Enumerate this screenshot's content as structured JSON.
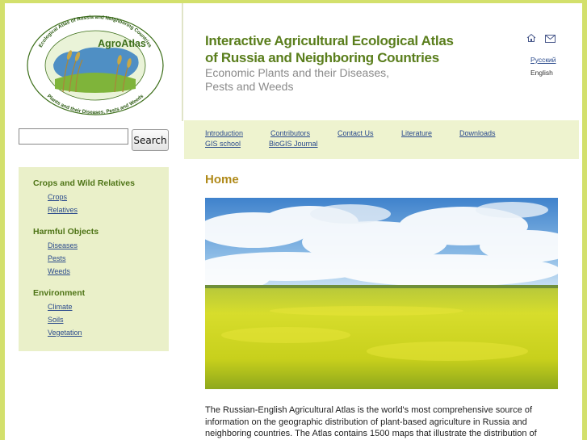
{
  "logo": {
    "brand": "AgroAtlas",
    "ring_text_top": "Ecological Atlas of Russia and Neighboring Countries",
    "ring_text_bottom": "Plants and their Diseases, Pests and Weeds"
  },
  "header": {
    "title_line1": "Interactive Agricultural Ecological Atlas",
    "title_line2": "of Russia and Neighboring Countries",
    "subtitle_line1": "Economic Plants and their Diseases,",
    "subtitle_line2": "Pests and Weeds"
  },
  "utility": {
    "home_icon": "home-icon",
    "mail_icon": "mail-icon",
    "lang_russian": "Русский",
    "lang_english": "English"
  },
  "search": {
    "button_label": "Search",
    "value": ""
  },
  "nav": [
    {
      "label": "Introduction"
    },
    {
      "label": "Contributors"
    },
    {
      "label": "Contact Us"
    },
    {
      "label": "Literature"
    },
    {
      "label": "Downloads"
    },
    {
      "label": "GIS school"
    },
    {
      "label": "BioGIS Journal"
    }
  ],
  "sidebar": {
    "sections": [
      {
        "heading": "Crops and Wild Relatives",
        "links": [
          "Crops",
          "Relatives"
        ]
      },
      {
        "heading": "Harmful Objects",
        "links": [
          "Diseases",
          "Pests",
          "Weeds"
        ]
      },
      {
        "heading": "Environment",
        "links": [
          "Climate",
          "Soils",
          "Vegetation"
        ]
      }
    ]
  },
  "main": {
    "page_title": "Home",
    "hero_alt": "rapeseed-field-photo",
    "body_line1": "The Russian-English Agricultural Atlas is the world's most comprehensive source of",
    "body_line2": "information on the geographic distribution of plant-based agriculture in Russia and",
    "body_line3": "neighboring countries. The Atlas contains 1500 maps that illustrate the distribution of"
  },
  "colors": {
    "frame_green": "#d3e06c",
    "title_green": "#5a7e1c",
    "sidebar_bg": "#eaf0c9",
    "navbar_bg": "#eef3cf",
    "page_title_gold": "#b08a1a",
    "link_blue": "#2a4a8c"
  }
}
